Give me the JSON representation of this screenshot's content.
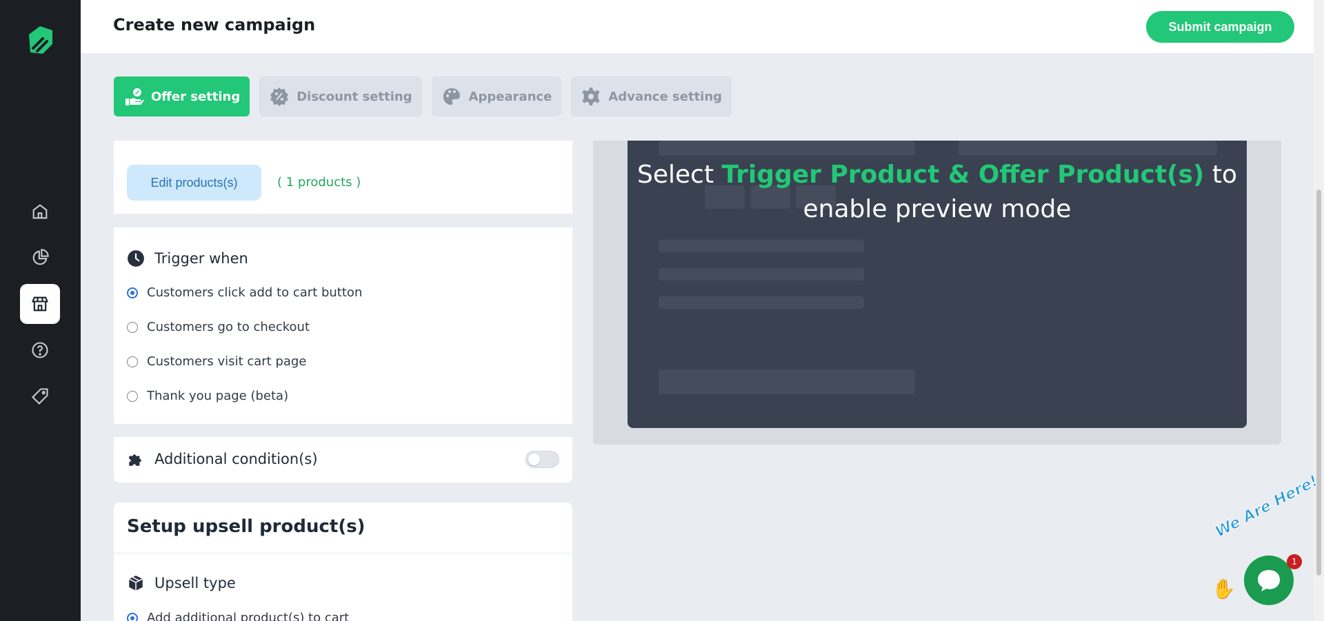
{
  "header": {
    "title": "Create new campaign",
    "submit_label": "Submit campaign"
  },
  "sidebar": {
    "items": [
      {
        "name": "home",
        "icon": "home-icon"
      },
      {
        "name": "analytics",
        "icon": "pie-chart-icon"
      },
      {
        "name": "store",
        "icon": "store-icon",
        "active": true
      },
      {
        "name": "help",
        "icon": "help-icon"
      },
      {
        "name": "offers",
        "icon": "tag-icon"
      }
    ]
  },
  "tabs": [
    {
      "label": "Offer setting",
      "icon": "offer-hand-icon",
      "active": true
    },
    {
      "label": "Discount setting",
      "icon": "discount-badge-icon"
    },
    {
      "label": "Appearance",
      "icon": "palette-icon"
    },
    {
      "label": "Advance setting",
      "icon": "gear-icon"
    }
  ],
  "products": {
    "edit_label": "Edit products(s)",
    "count_label": "( 1 products )"
  },
  "trigger": {
    "title": "Trigger when",
    "options": [
      {
        "label": "Customers click add to cart button",
        "checked": true
      },
      {
        "label": "Customers go to checkout",
        "checked": false
      },
      {
        "label": "Customers visit cart page",
        "checked": false
      },
      {
        "label": "Thank you page (beta)",
        "checked": false
      }
    ]
  },
  "additional": {
    "title": "Additional condition(s)",
    "enabled": false
  },
  "upsell": {
    "title": "Setup upsell product(s)",
    "type_title": "Upsell type",
    "first_option": "Add additional product(s) to cart"
  },
  "preview": {
    "msg_prefix": "Select",
    "msg_highlight": "Trigger Product & Offer Product(s)",
    "msg_suffix": "to",
    "msg_line2": "enable preview mode"
  },
  "chat": {
    "label": "We Are Here!",
    "badge": "1"
  },
  "colors": {
    "accent": "#22c777",
    "sidebar": "#1b1f24",
    "preview_bg": "#3a4150",
    "link_blue": "#2a72b5"
  }
}
